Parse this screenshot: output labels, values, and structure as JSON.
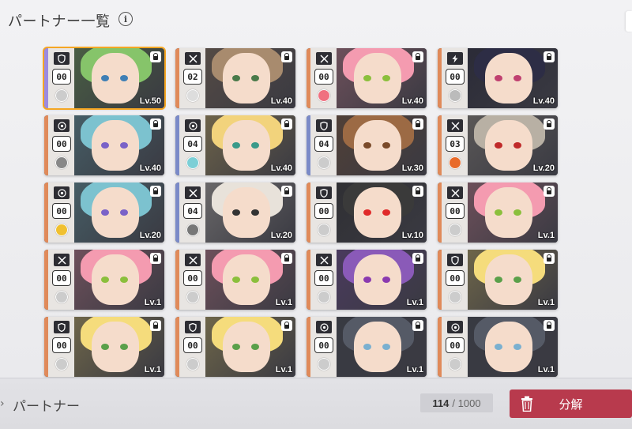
{
  "header": {
    "title": "パートナー一覧",
    "info_icon": "i"
  },
  "colors": {
    "accent_selected": "#f5a623",
    "decompose_button": "#b83a4d"
  },
  "cards": [
    {
      "count": "00",
      "level": "Lv.50",
      "class_icon": "shield-icon",
      "stripe": "#9c8be0",
      "hair": "#86c46a",
      "eye": "#3f7fb5",
      "avatar": "#ccc",
      "selected": true
    },
    {
      "count": "02",
      "level": "Lv.40",
      "class_icon": "crossed-swords-icon",
      "stripe": "#e08a5a",
      "hair": "#a88b6e",
      "eye": "#4a7a4a",
      "avatar": "#ddd"
    },
    {
      "count": "00",
      "level": "Lv.40",
      "class_icon": "crossed-swords-icon",
      "stripe": "#e08a5a",
      "hair": "#f49bb0",
      "eye": "#8bbf3c",
      "avatar": "#f07080"
    },
    {
      "count": "00",
      "level": "Lv.40",
      "class_icon": "lightning-icon",
      "stripe": "#e08a5a",
      "hair": "#2d2d45",
      "eye": "#c04070",
      "avatar": "#bbb"
    },
    {
      "count": "00",
      "level": "Lv.40",
      "class_icon": "target-icon",
      "stripe": "#e08a5a",
      "hair": "#7cc2cf",
      "eye": "#7a62c8",
      "avatar": "#888"
    },
    {
      "count": "04",
      "level": "Lv.40",
      "class_icon": "target-icon",
      "stripe": "#7a8ac8",
      "hair": "#f2d37c",
      "eye": "#3a9a8a",
      "avatar": "#7ccfd6"
    },
    {
      "count": "04",
      "level": "Lv.30",
      "class_icon": "shield-icon",
      "stripe": "#7a8ac8",
      "hair": "#9c6a44",
      "eye": "#7a4a2a",
      "avatar": "#ccc"
    },
    {
      "count": "03",
      "level": "Lv.20",
      "class_icon": "crossed-swords-icon",
      "stripe": "#e08a5a",
      "hair": "#b8b0a4",
      "eye": "#c02a2a",
      "avatar": "#e86a2a"
    },
    {
      "count": "00",
      "level": "Lv.20",
      "class_icon": "target-icon",
      "stripe": "#e08a5a",
      "hair": "#7cc2cf",
      "eye": "#7a62c8",
      "avatar": "#f0c030"
    },
    {
      "count": "04",
      "level": "Lv.20",
      "class_icon": "crossed-swords-icon",
      "stripe": "#7a8ac8",
      "hair": "#e8e2da",
      "eye": "#333",
      "avatar": "#777"
    },
    {
      "count": "00",
      "level": "Lv.10",
      "class_icon": "shield-icon",
      "stripe": "#e08a5a",
      "hair": "#3a3a3a",
      "eye": "#e02a2a",
      "avatar": "#ccc"
    },
    {
      "count": "00",
      "level": "Lv.1",
      "class_icon": "crossed-swords-icon",
      "stripe": "#e08a5a",
      "hair": "#f49bb0",
      "eye": "#8bbf3c",
      "avatar": "#ccc"
    },
    {
      "count": "00",
      "level": "Lv.1",
      "class_icon": "crossed-swords-icon",
      "stripe": "#e08a5a",
      "hair": "#f49bb0",
      "eye": "#8bbf3c",
      "avatar": "#ccc"
    },
    {
      "count": "00",
      "level": "Lv.1",
      "class_icon": "crossed-swords-icon",
      "stripe": "#e08a5a",
      "hair": "#f49bb0",
      "eye": "#8bbf3c",
      "avatar": "#ccc"
    },
    {
      "count": "00",
      "level": "Lv.1",
      "class_icon": "crossed-swords-icon",
      "stripe": "#e08a5a",
      "hair": "#8a5ab8",
      "eye": "#8a3ab0",
      "avatar": "#ccc"
    },
    {
      "count": "00",
      "level": "Lv.1",
      "class_icon": "shield-icon",
      "stripe": "#e08a5a",
      "hair": "#f5dc7c",
      "eye": "#5aa04a",
      "avatar": "#ccc"
    },
    {
      "count": "00",
      "level": "Lv.1",
      "class_icon": "shield-icon",
      "stripe": "#e08a5a",
      "hair": "#f5dc7c",
      "eye": "#5aa04a",
      "avatar": "#ccc"
    },
    {
      "count": "00",
      "level": "Lv.1",
      "class_icon": "shield-icon",
      "stripe": "#e08a5a",
      "hair": "#f5dc7c",
      "eye": "#5aa04a",
      "avatar": "#ccc"
    },
    {
      "count": "00",
      "level": "Lv.1",
      "class_icon": "target-icon",
      "stripe": "#e08a5a",
      "hair": "#555a66",
      "eye": "#7ab0d0",
      "avatar": "#ccc"
    },
    {
      "count": "00",
      "level": "Lv.1",
      "class_icon": "target-icon",
      "stripe": "#e08a5a",
      "hair": "#555a66",
      "eye": "#7ab0d0",
      "avatar": "#ccc"
    }
  ],
  "footer": {
    "label": "パートナー",
    "count_current": "114",
    "count_max": "/ 1000",
    "decompose_label": "分解"
  }
}
